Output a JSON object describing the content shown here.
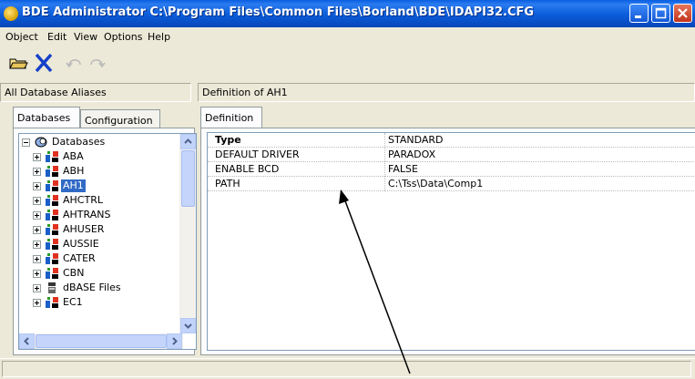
{
  "window": {
    "title": "BDE Administrator  C:\\Program Files\\Common Files\\Borland\\BDE\\IDAPI32.CFG"
  },
  "menu": [
    "Object",
    "Edit",
    "View",
    "Options",
    "Help"
  ],
  "toolbar": {
    "icons": [
      "open-icon",
      "delete-icon",
      "undo-icon",
      "redo-icon"
    ]
  },
  "left_panel": {
    "header": "All Database Aliases",
    "tabs": [
      "Databases",
      "Configuration"
    ],
    "tree": {
      "root": "Databases",
      "items": [
        "ABA",
        "ABH",
        "AH1",
        "AHCTRL",
        "AHTRANS",
        "AHUSER",
        "AUSSIE",
        "CATER",
        "CBN",
        "dBASE Files",
        "EC1"
      ],
      "selected": "AH1"
    }
  },
  "right_panel": {
    "header": "Definition of AH1",
    "tabs": [
      "Definition"
    ],
    "rows": [
      {
        "key": "Type",
        "value": "STANDARD"
      },
      {
        "key": "DEFAULT DRIVER",
        "value": "PARADOX"
      },
      {
        "key": "ENABLE BCD",
        "value": "FALSE"
      },
      {
        "key": "PATH",
        "value": "C:\\Tss\\Data\\Comp1"
      }
    ]
  },
  "colors": {
    "titlebar": "#0b5cd9",
    "selection": "#316ac5",
    "chrome": "#ece9d8"
  }
}
